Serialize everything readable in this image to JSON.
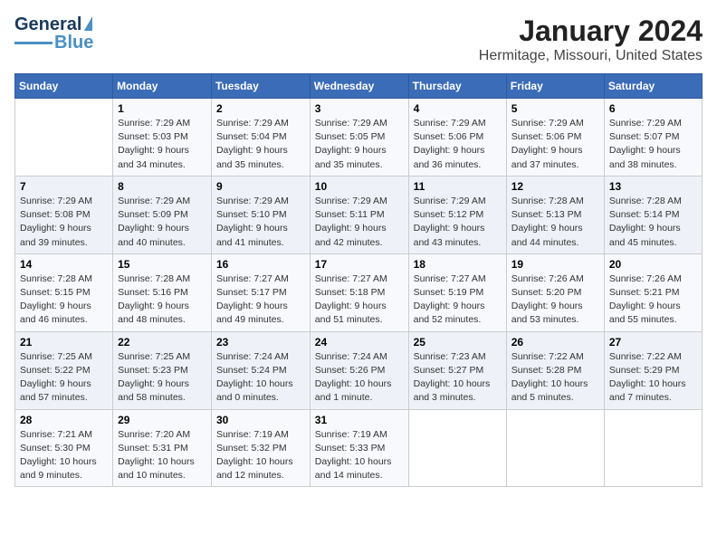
{
  "logo": {
    "line1": "General",
    "line2": "Blue"
  },
  "title": "January 2024",
  "subtitle": "Hermitage, Missouri, United States",
  "days_of_week": [
    "Sunday",
    "Monday",
    "Tuesday",
    "Wednesday",
    "Thursday",
    "Friday",
    "Saturday"
  ],
  "weeks": [
    [
      {
        "day": "",
        "sunrise": "",
        "sunset": "",
        "daylight": ""
      },
      {
        "day": "1",
        "sunrise": "Sunrise: 7:29 AM",
        "sunset": "Sunset: 5:03 PM",
        "daylight": "Daylight: 9 hours and 34 minutes."
      },
      {
        "day": "2",
        "sunrise": "Sunrise: 7:29 AM",
        "sunset": "Sunset: 5:04 PM",
        "daylight": "Daylight: 9 hours and 35 minutes."
      },
      {
        "day": "3",
        "sunrise": "Sunrise: 7:29 AM",
        "sunset": "Sunset: 5:05 PM",
        "daylight": "Daylight: 9 hours and 35 minutes."
      },
      {
        "day": "4",
        "sunrise": "Sunrise: 7:29 AM",
        "sunset": "Sunset: 5:06 PM",
        "daylight": "Daylight: 9 hours and 36 minutes."
      },
      {
        "day": "5",
        "sunrise": "Sunrise: 7:29 AM",
        "sunset": "Sunset: 5:06 PM",
        "daylight": "Daylight: 9 hours and 37 minutes."
      },
      {
        "day": "6",
        "sunrise": "Sunrise: 7:29 AM",
        "sunset": "Sunset: 5:07 PM",
        "daylight": "Daylight: 9 hours and 38 minutes."
      }
    ],
    [
      {
        "day": "7",
        "sunrise": "Sunrise: 7:29 AM",
        "sunset": "Sunset: 5:08 PM",
        "daylight": "Daylight: 9 hours and 39 minutes."
      },
      {
        "day": "8",
        "sunrise": "Sunrise: 7:29 AM",
        "sunset": "Sunset: 5:09 PM",
        "daylight": "Daylight: 9 hours and 40 minutes."
      },
      {
        "day": "9",
        "sunrise": "Sunrise: 7:29 AM",
        "sunset": "Sunset: 5:10 PM",
        "daylight": "Daylight: 9 hours and 41 minutes."
      },
      {
        "day": "10",
        "sunrise": "Sunrise: 7:29 AM",
        "sunset": "Sunset: 5:11 PM",
        "daylight": "Daylight: 9 hours and 42 minutes."
      },
      {
        "day": "11",
        "sunrise": "Sunrise: 7:29 AM",
        "sunset": "Sunset: 5:12 PM",
        "daylight": "Daylight: 9 hours and 43 minutes."
      },
      {
        "day": "12",
        "sunrise": "Sunrise: 7:28 AM",
        "sunset": "Sunset: 5:13 PM",
        "daylight": "Daylight: 9 hours and 44 minutes."
      },
      {
        "day": "13",
        "sunrise": "Sunrise: 7:28 AM",
        "sunset": "Sunset: 5:14 PM",
        "daylight": "Daylight: 9 hours and 45 minutes."
      }
    ],
    [
      {
        "day": "14",
        "sunrise": "Sunrise: 7:28 AM",
        "sunset": "Sunset: 5:15 PM",
        "daylight": "Daylight: 9 hours and 46 minutes."
      },
      {
        "day": "15",
        "sunrise": "Sunrise: 7:28 AM",
        "sunset": "Sunset: 5:16 PM",
        "daylight": "Daylight: 9 hours and 48 minutes."
      },
      {
        "day": "16",
        "sunrise": "Sunrise: 7:27 AM",
        "sunset": "Sunset: 5:17 PM",
        "daylight": "Daylight: 9 hours and 49 minutes."
      },
      {
        "day": "17",
        "sunrise": "Sunrise: 7:27 AM",
        "sunset": "Sunset: 5:18 PM",
        "daylight": "Daylight: 9 hours and 51 minutes."
      },
      {
        "day": "18",
        "sunrise": "Sunrise: 7:27 AM",
        "sunset": "Sunset: 5:19 PM",
        "daylight": "Daylight: 9 hours and 52 minutes."
      },
      {
        "day": "19",
        "sunrise": "Sunrise: 7:26 AM",
        "sunset": "Sunset: 5:20 PM",
        "daylight": "Daylight: 9 hours and 53 minutes."
      },
      {
        "day": "20",
        "sunrise": "Sunrise: 7:26 AM",
        "sunset": "Sunset: 5:21 PM",
        "daylight": "Daylight: 9 hours and 55 minutes."
      }
    ],
    [
      {
        "day": "21",
        "sunrise": "Sunrise: 7:25 AM",
        "sunset": "Sunset: 5:22 PM",
        "daylight": "Daylight: 9 hours and 57 minutes."
      },
      {
        "day": "22",
        "sunrise": "Sunrise: 7:25 AM",
        "sunset": "Sunset: 5:23 PM",
        "daylight": "Daylight: 9 hours and 58 minutes."
      },
      {
        "day": "23",
        "sunrise": "Sunrise: 7:24 AM",
        "sunset": "Sunset: 5:24 PM",
        "daylight": "Daylight: 10 hours and 0 minutes."
      },
      {
        "day": "24",
        "sunrise": "Sunrise: 7:24 AM",
        "sunset": "Sunset: 5:26 PM",
        "daylight": "Daylight: 10 hours and 1 minute."
      },
      {
        "day": "25",
        "sunrise": "Sunrise: 7:23 AM",
        "sunset": "Sunset: 5:27 PM",
        "daylight": "Daylight: 10 hours and 3 minutes."
      },
      {
        "day": "26",
        "sunrise": "Sunrise: 7:22 AM",
        "sunset": "Sunset: 5:28 PM",
        "daylight": "Daylight: 10 hours and 5 minutes."
      },
      {
        "day": "27",
        "sunrise": "Sunrise: 7:22 AM",
        "sunset": "Sunset: 5:29 PM",
        "daylight": "Daylight: 10 hours and 7 minutes."
      }
    ],
    [
      {
        "day": "28",
        "sunrise": "Sunrise: 7:21 AM",
        "sunset": "Sunset: 5:30 PM",
        "daylight": "Daylight: 10 hours and 9 minutes."
      },
      {
        "day": "29",
        "sunrise": "Sunrise: 7:20 AM",
        "sunset": "Sunset: 5:31 PM",
        "daylight": "Daylight: 10 hours and 10 minutes."
      },
      {
        "day": "30",
        "sunrise": "Sunrise: 7:19 AM",
        "sunset": "Sunset: 5:32 PM",
        "daylight": "Daylight: 10 hours and 12 minutes."
      },
      {
        "day": "31",
        "sunrise": "Sunrise: 7:19 AM",
        "sunset": "Sunset: 5:33 PM",
        "daylight": "Daylight: 10 hours and 14 minutes."
      },
      {
        "day": "",
        "sunrise": "",
        "sunset": "",
        "daylight": ""
      },
      {
        "day": "",
        "sunrise": "",
        "sunset": "",
        "daylight": ""
      },
      {
        "day": "",
        "sunrise": "",
        "sunset": "",
        "daylight": ""
      }
    ]
  ]
}
